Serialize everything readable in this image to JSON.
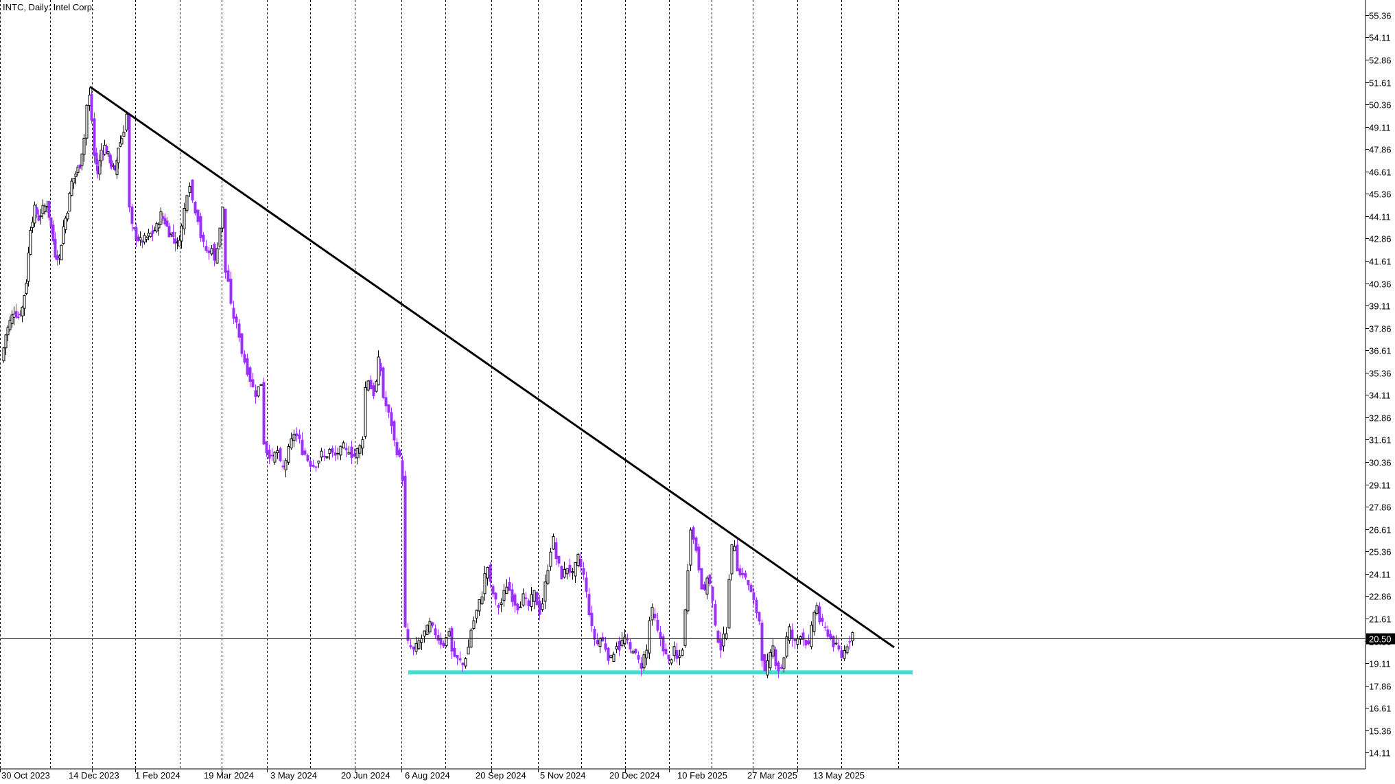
{
  "chart_data": {
    "type": "candlestick",
    "symbol": "INTC",
    "timeframe": "Daily",
    "company": "Intel Corp.",
    "title": "INTC, Daily:  Intel Corp.",
    "current_price": 20.5,
    "ylim": [
      13.2,
      56.2
    ],
    "y_ticks": [
      "55.36",
      "54.11",
      "52.86",
      "51.61",
      "50.36",
      "49.11",
      "47.86",
      "46.61",
      "45.36",
      "44.11",
      "42.86",
      "41.61",
      "40.36",
      "39.11",
      "37.86",
      "36.61",
      "35.36",
      "34.11",
      "32.86",
      "31.61",
      "30.36",
      "29.11",
      "27.86",
      "26.61",
      "25.36",
      "24.11",
      "22.86",
      "21.61",
      "20.36",
      "19.11",
      "17.86",
      "16.61",
      "15.36",
      "14.11"
    ],
    "x_labels": [
      "30 Oct 2023",
      "14 Dec 2023",
      "1 Feb 2024",
      "19 Mar 2024",
      "3 May 2024",
      "20 Jun 2024",
      "6 Aug 2024",
      "20 Sep 2024",
      "5 Nov 2024",
      "20 Dec 2024",
      "10 Feb 2025",
      "27 Mar 2025",
      "13 May 2025"
    ],
    "bull_color": "#000000",
    "bear_color": "#9b30ff",
    "close_path": [
      [
        0,
        36.0
      ],
      [
        6,
        37.5
      ],
      [
        12,
        38.2
      ],
      [
        18,
        38.8
      ],
      [
        24,
        38.5
      ],
      [
        30,
        39.0
      ],
      [
        36,
        40.5
      ],
      [
        42,
        43.5
      ],
      [
        48,
        44.5
      ],
      [
        54,
        44.0
      ],
      [
        60,
        44.5
      ],
      [
        66,
        44.8
      ],
      [
        72,
        43.5
      ],
      [
        78,
        42.0
      ],
      [
        84,
        41.8
      ],
      [
        90,
        43.5
      ],
      [
        96,
        44.5
      ],
      [
        102,
        46.0
      ],
      [
        108,
        46.5
      ],
      [
        114,
        47.0
      ],
      [
        120,
        48.5
      ],
      [
        124,
        50.3
      ],
      [
        128,
        50.8
      ],
      [
        131,
        49.5
      ],
      [
        135,
        47.5
      ],
      [
        140,
        46.5
      ],
      [
        145,
        47.8
      ],
      [
        150,
        48.0
      ],
      [
        155,
        47.5
      ],
      [
        160,
        47.0
      ],
      [
        165,
        46.5
      ],
      [
        170,
        48.0
      ],
      [
        175,
        48.5
      ],
      [
        178,
        49.0
      ],
      [
        182,
        49.8
      ],
      [
        186,
        44.5
      ],
      [
        190,
        43.5
      ],
      [
        196,
        43.0
      ],
      [
        202,
        42.7
      ],
      [
        208,
        42.8
      ],
      [
        214,
        43.0
      ],
      [
        220,
        43.2
      ],
      [
        226,
        43.5
      ],
      [
        232,
        44.2
      ],
      [
        238,
        43.8
      ],
      [
        244,
        43.2
      ],
      [
        250,
        43.0
      ],
      [
        256,
        42.5
      ],
      [
        262,
        43.5
      ],
      [
        266,
        44.5
      ],
      [
        270,
        45.5
      ],
      [
        274,
        46.0
      ],
      [
        278,
        45.0
      ],
      [
        282,
        44.5
      ],
      [
        286,
        44.0
      ],
      [
        290,
        43.0
      ],
      [
        294,
        42.5
      ],
      [
        298,
        42.2
      ],
      [
        302,
        42.0
      ],
      [
        306,
        42.5
      ],
      [
        310,
        41.5
      ],
      [
        314,
        42.5
      ],
      [
        318,
        43.5
      ],
      [
        322,
        44.5
      ],
      [
        326,
        41.0
      ],
      [
        330,
        40.5
      ],
      [
        334,
        39.0
      ],
      [
        338,
        38.5
      ],
      [
        342,
        38.0
      ],
      [
        346,
        37.5
      ],
      [
        350,
        36.5
      ],
      [
        354,
        36.0
      ],
      [
        358,
        35.5
      ],
      [
        362,
        35.0
      ],
      [
        366,
        34.5
      ],
      [
        370,
        34.2
      ],
      [
        374,
        34.5
      ],
      [
        378,
        34.8
      ],
      [
        382,
        31.5
      ],
      [
        386,
        31.0
      ],
      [
        390,
        30.8
      ],
      [
        394,
        30.5
      ],
      [
        398,
        30.8
      ],
      [
        402,
        31.0
      ],
      [
        406,
        30.2
      ],
      [
        410,
        30.0
      ],
      [
        414,
        30.5
      ],
      [
        418,
        31.0
      ],
      [
        422,
        31.5
      ],
      [
        426,
        32.0
      ],
      [
        430,
        31.8
      ],
      [
        434,
        31.5
      ],
      [
        438,
        31.0
      ],
      [
        442,
        30.8
      ],
      [
        446,
        30.5
      ],
      [
        450,
        30.3
      ],
      [
        454,
        30.2
      ],
      [
        458,
        30.3
      ],
      [
        462,
        30.5
      ],
      [
        466,
        30.8
      ],
      [
        470,
        30.6
      ],
      [
        474,
        30.8
      ],
      [
        478,
        31.0
      ],
      [
        482,
        30.8
      ],
      [
        486,
        30.7
      ],
      [
        490,
        30.9
      ],
      [
        494,
        31.0
      ],
      [
        498,
        31.2
      ],
      [
        502,
        30.9
      ],
      [
        506,
        31.1
      ],
      [
        510,
        30.8
      ],
      [
        514,
        30.7
      ],
      [
        518,
        31.0
      ],
      [
        522,
        31.2
      ],
      [
        526,
        31.8
      ],
      [
        530,
        34.5
      ],
      [
        534,
        35.0
      ],
      [
        538,
        34.5
      ],
      [
        542,
        34.2
      ],
      [
        546,
        34.8
      ],
      [
        549,
        36.0
      ],
      [
        552,
        35.5
      ],
      [
        556,
        34.0
      ],
      [
        560,
        33.5
      ],
      [
        564,
        33.0
      ],
      [
        568,
        32.5
      ],
      [
        572,
        31.5
      ],
      [
        576,
        31.0
      ],
      [
        580,
        30.5
      ],
      [
        584,
        29.5
      ],
      [
        588,
        21.0
      ],
      [
        592,
        20.2
      ],
      [
        596,
        20.0
      ],
      [
        600,
        19.8
      ],
      [
        604,
        20.0
      ],
      [
        608,
        20.3
      ],
      [
        612,
        20.5
      ],
      [
        616,
        20.8
      ],
      [
        620,
        21.0
      ],
      [
        624,
        21.3
      ],
      [
        628,
        21.0
      ],
      [
        632,
        20.8
      ],
      [
        636,
        20.5
      ],
      [
        640,
        20.3
      ],
      [
        644,
        20.2
      ],
      [
        648,
        20.5
      ],
      [
        652,
        21.0
      ],
      [
        656,
        19.8
      ],
      [
        660,
        19.5
      ],
      [
        664,
        19.3
      ],
      [
        668,
        19.2
      ],
      [
        672,
        19.0
      ],
      [
        676,
        19.5
      ],
      [
        680,
        20.0
      ],
      [
        684,
        21.0
      ],
      [
        688,
        21.5
      ],
      [
        692,
        22.0
      ],
      [
        696,
        22.5
      ],
      [
        700,
        23.0
      ],
      [
        704,
        24.0
      ],
      [
        708,
        24.5
      ],
      [
        712,
        23.5
      ],
      [
        716,
        23.0
      ],
      [
        720,
        22.5
      ],
      [
        724,
        22.3
      ],
      [
        728,
        22.5
      ],
      [
        732,
        23.0
      ],
      [
        736,
        23.5
      ],
      [
        740,
        23.2
      ],
      [
        744,
        22.8
      ],
      [
        748,
        22.5
      ],
      [
        752,
        22.3
      ],
      [
        756,
        22.5
      ],
      [
        760,
        22.8
      ],
      [
        764,
        22.5
      ],
      [
        768,
        22.3
      ],
      [
        772,
        22.7
      ],
      [
        776,
        23.0
      ],
      [
        780,
        22.5
      ],
      [
        784,
        22.0
      ],
      [
        788,
        22.5
      ],
      [
        792,
        23.5
      ],
      [
        796,
        24.5
      ],
      [
        800,
        25.5
      ],
      [
        804,
        26.0
      ],
      [
        808,
        25.0
      ],
      [
        812,
        24.5
      ],
      [
        816,
        24.0
      ],
      [
        820,
        24.2
      ],
      [
        824,
        24.5
      ],
      [
        828,
        24.3
      ],
      [
        832,
        24.0
      ],
      [
        836,
        24.5
      ],
      [
        840,
        25.0
      ],
      [
        844,
        24.5
      ],
      [
        848,
        24.0
      ],
      [
        852,
        23.0
      ],
      [
        856,
        22.0
      ],
      [
        860,
        21.0
      ],
      [
        864,
        20.5
      ],
      [
        868,
        20.2
      ],
      [
        872,
        20.5
      ],
      [
        876,
        20.3
      ],
      [
        880,
        20.0
      ],
      [
        884,
        19.5
      ],
      [
        888,
        19.3
      ],
      [
        892,
        19.8
      ],
      [
        896,
        20.2
      ],
      [
        900,
        20.0
      ],
      [
        904,
        20.3
      ],
      [
        908,
        20.5
      ],
      [
        912,
        20.2
      ],
      [
        916,
        19.8
      ],
      [
        920,
        20.0
      ],
      [
        924,
        19.5
      ],
      [
        928,
        19.2
      ],
      [
        932,
        19.0
      ],
      [
        936,
        19.5
      ],
      [
        940,
        19.8
      ],
      [
        944,
        21.5
      ],
      [
        948,
        22.0
      ],
      [
        952,
        21.5
      ],
      [
        956,
        20.8
      ],
      [
        960,
        20.5
      ],
      [
        964,
        20.0
      ],
      [
        968,
        19.5
      ],
      [
        972,
        19.2
      ],
      [
        976,
        19.5
      ],
      [
        980,
        19.8
      ],
      [
        984,
        19.3
      ],
      [
        988,
        19.5
      ],
      [
        992,
        20.0
      ],
      [
        996,
        22.0
      ],
      [
        1000,
        24.5
      ],
      [
        1004,
        26.8
      ],
      [
        1008,
        26.0
      ],
      [
        1012,
        25.5
      ],
      [
        1016,
        24.5
      ],
      [
        1020,
        23.5
      ],
      [
        1024,
        23.0
      ],
      [
        1028,
        24.0
      ],
      [
        1032,
        23.5
      ],
      [
        1036,
        22.5
      ],
      [
        1040,
        21.0
      ],
      [
        1044,
        20.5
      ],
      [
        1048,
        20.0
      ],
      [
        1052,
        20.5
      ],
      [
        1056,
        21.0
      ],
      [
        1060,
        24.0
      ],
      [
        1064,
        25.5
      ],
      [
        1068,
        25.8
      ],
      [
        1072,
        24.5
      ],
      [
        1076,
        24.0
      ],
      [
        1080,
        24.2
      ],
      [
        1084,
        23.8
      ],
      [
        1088,
        23.5
      ],
      [
        1092,
        23.0
      ],
      [
        1096,
        22.5
      ],
      [
        1100,
        22.0
      ],
      [
        1104,
        21.5
      ],
      [
        1108,
        19.5
      ],
      [
        1112,
        18.5
      ],
      [
        1116,
        19.0
      ],
      [
        1120,
        19.5
      ],
      [
        1124,
        20.0
      ],
      [
        1128,
        19.2
      ],
      [
        1132,
        18.8
      ],
      [
        1136,
        18.9
      ],
      [
        1140,
        19.5
      ],
      [
        1144,
        20.5
      ],
      [
        1148,
        21.0
      ],
      [
        1152,
        20.5
      ],
      [
        1156,
        20.2
      ],
      [
        1160,
        20.5
      ],
      [
        1164,
        20.8
      ],
      [
        1168,
        20.5
      ],
      [
        1172,
        20.3
      ],
      [
        1176,
        20.0
      ],
      [
        1180,
        21.0
      ],
      [
        1184,
        22.0
      ],
      [
        1188,
        22.3
      ],
      [
        1192,
        21.5
      ],
      [
        1196,
        21.2
      ],
      [
        1200,
        21.0
      ],
      [
        1204,
        20.8
      ],
      [
        1208,
        20.5
      ],
      [
        1212,
        20.2
      ],
      [
        1216,
        20.0
      ],
      [
        1220,
        19.8
      ],
      [
        1224,
        19.5
      ],
      [
        1228,
        19.8
      ],
      [
        1232,
        20.2
      ],
      [
        1236,
        20.5
      ],
      [
        1240,
        20.8
      ]
    ],
    "trendline": {
      "color": "#000000",
      "start": {
        "date": "14 Dec 2023",
        "price": 51.35
      },
      "end": {
        "date": "after 13 May 2025",
        "price": 20.0
      }
    },
    "support_line": {
      "color": "#40e0d0",
      "price": 18.6,
      "from": "6 Aug 2024",
      "to": "after 13 May 2025"
    }
  }
}
